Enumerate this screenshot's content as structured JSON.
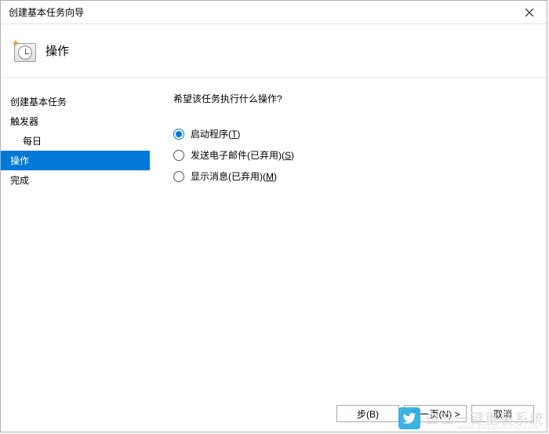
{
  "window": {
    "title": "创建基本任务向导"
  },
  "header": {
    "title": "操作"
  },
  "sidebar": {
    "items": [
      {
        "label": "创建基本任务",
        "indent": false,
        "selected": false
      },
      {
        "label": "触发器",
        "indent": false,
        "selected": false
      },
      {
        "label": "每日",
        "indent": true,
        "selected": false
      },
      {
        "label": "操作",
        "indent": false,
        "selected": true
      },
      {
        "label": "完成",
        "indent": false,
        "selected": false
      }
    ]
  },
  "main": {
    "question": "希望该任务执行什么操作?",
    "options": [
      {
        "label": "启动程序",
        "accel": "T",
        "checked": true
      },
      {
        "label": "发送电子邮件(已弃用)",
        "accel": "S",
        "checked": false
      },
      {
        "label": "显示消息(已弃用)",
        "accel": "M",
        "checked": false
      }
    ]
  },
  "footer": {
    "back": "步(B)",
    "next": "下一页(N) >",
    "cancel": "取消"
  },
  "watermark": {
    "text": "白云一键重装系统",
    "sub": "www.baiyunxitong.com"
  }
}
